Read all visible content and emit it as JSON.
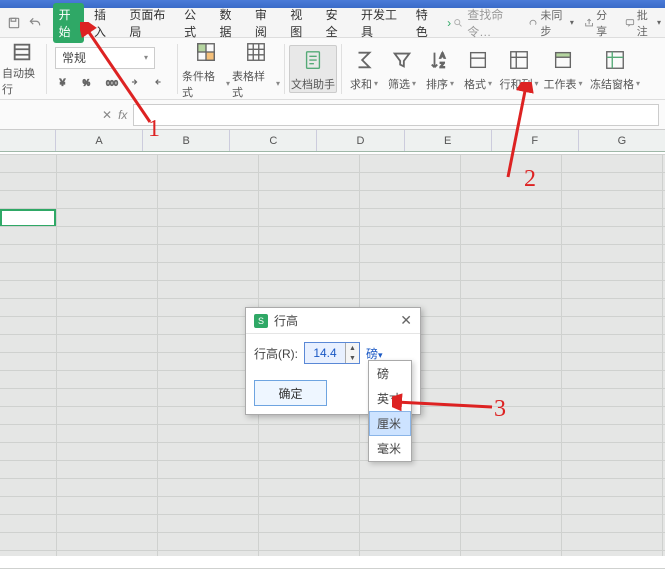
{
  "tabs": {
    "start": "开始",
    "insert": "插入",
    "layout": "页面布局",
    "formula": "公式",
    "data": "数据",
    "review": "审阅",
    "view": "视图",
    "security": "安全",
    "dev": "开发工具",
    "special": "特色"
  },
  "search_placeholder": "查找命令…",
  "right": {
    "unsynced": "未同步",
    "share": "分享",
    "comment": "批注"
  },
  "ribbon": {
    "wrap": "自动换行",
    "number_format": "常规",
    "cond_format": "条件格式",
    "table_style": "表格样式",
    "doc_helper": "文档助手",
    "sum": "求和",
    "filter": "筛选",
    "sort": "排序",
    "format": "格式",
    "row_col": "行和列",
    "worksheet": "工作表",
    "freeze": "冻结窗格"
  },
  "columns": [
    "A",
    "B",
    "C",
    "D",
    "E",
    "F",
    "G"
  ],
  "dialog": {
    "title": "行高",
    "label": "行高(R):",
    "value": "14.4",
    "unit": "磅",
    "ok": "确定"
  },
  "units": [
    "磅",
    "英寸",
    "厘米",
    "毫米"
  ],
  "unit_selected_index": 2,
  "annotations": {
    "n1": "1",
    "n2": "2",
    "n3": "3"
  }
}
